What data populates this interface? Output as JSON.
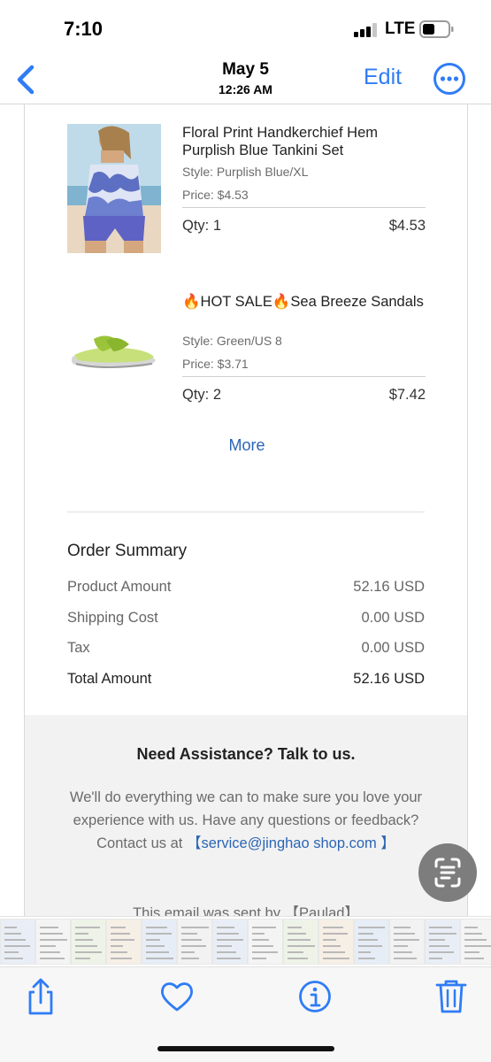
{
  "status_bar": {
    "time": "7:10",
    "network": "LTE"
  },
  "nav": {
    "date": "May 5",
    "time": "12:26 AM",
    "edit_label": "Edit"
  },
  "items": [
    {
      "name": "Floral Print Handkerchief Hem Purplish Blue Tankini Set",
      "style": "Style: Purplish Blue/XL",
      "price": "Price: $4.53",
      "qty": "Qty: 1",
      "amount": "$4.53"
    },
    {
      "name": "🔥HOT SALE🔥Sea Breeze Sandals",
      "style": "Style: Green/US 8",
      "price": "Price: $3.71",
      "qty": "Qty: 2",
      "amount": "$7.42"
    }
  ],
  "more_label": "More",
  "summary": {
    "title": "Order Summary",
    "rows": [
      {
        "label": "Product Amount",
        "value": "52.16 USD"
      },
      {
        "label": "Shipping Cost",
        "value": "0.00 USD"
      },
      {
        "label": "Tax",
        "value": "0.00 USD"
      },
      {
        "label": "Total Amount",
        "value": "52.16 USD"
      }
    ]
  },
  "assistance": {
    "title": "Need Assistance? Talk to us.",
    "text": "We'll do everything we can to make sure you love your experience with us. Have any questions or feedback? Contact us at ",
    "email": "【service@jinghao shop.com 】",
    "footer": "This email was sent by 【Paulad】"
  },
  "colors": {
    "accent": "#2f7cf6",
    "link": "#2b65b5"
  },
  "icons": [
    "back-chevron-icon",
    "more-options-icon",
    "live-text-icon",
    "share-icon",
    "heart-icon",
    "info-icon",
    "trash-icon"
  ]
}
